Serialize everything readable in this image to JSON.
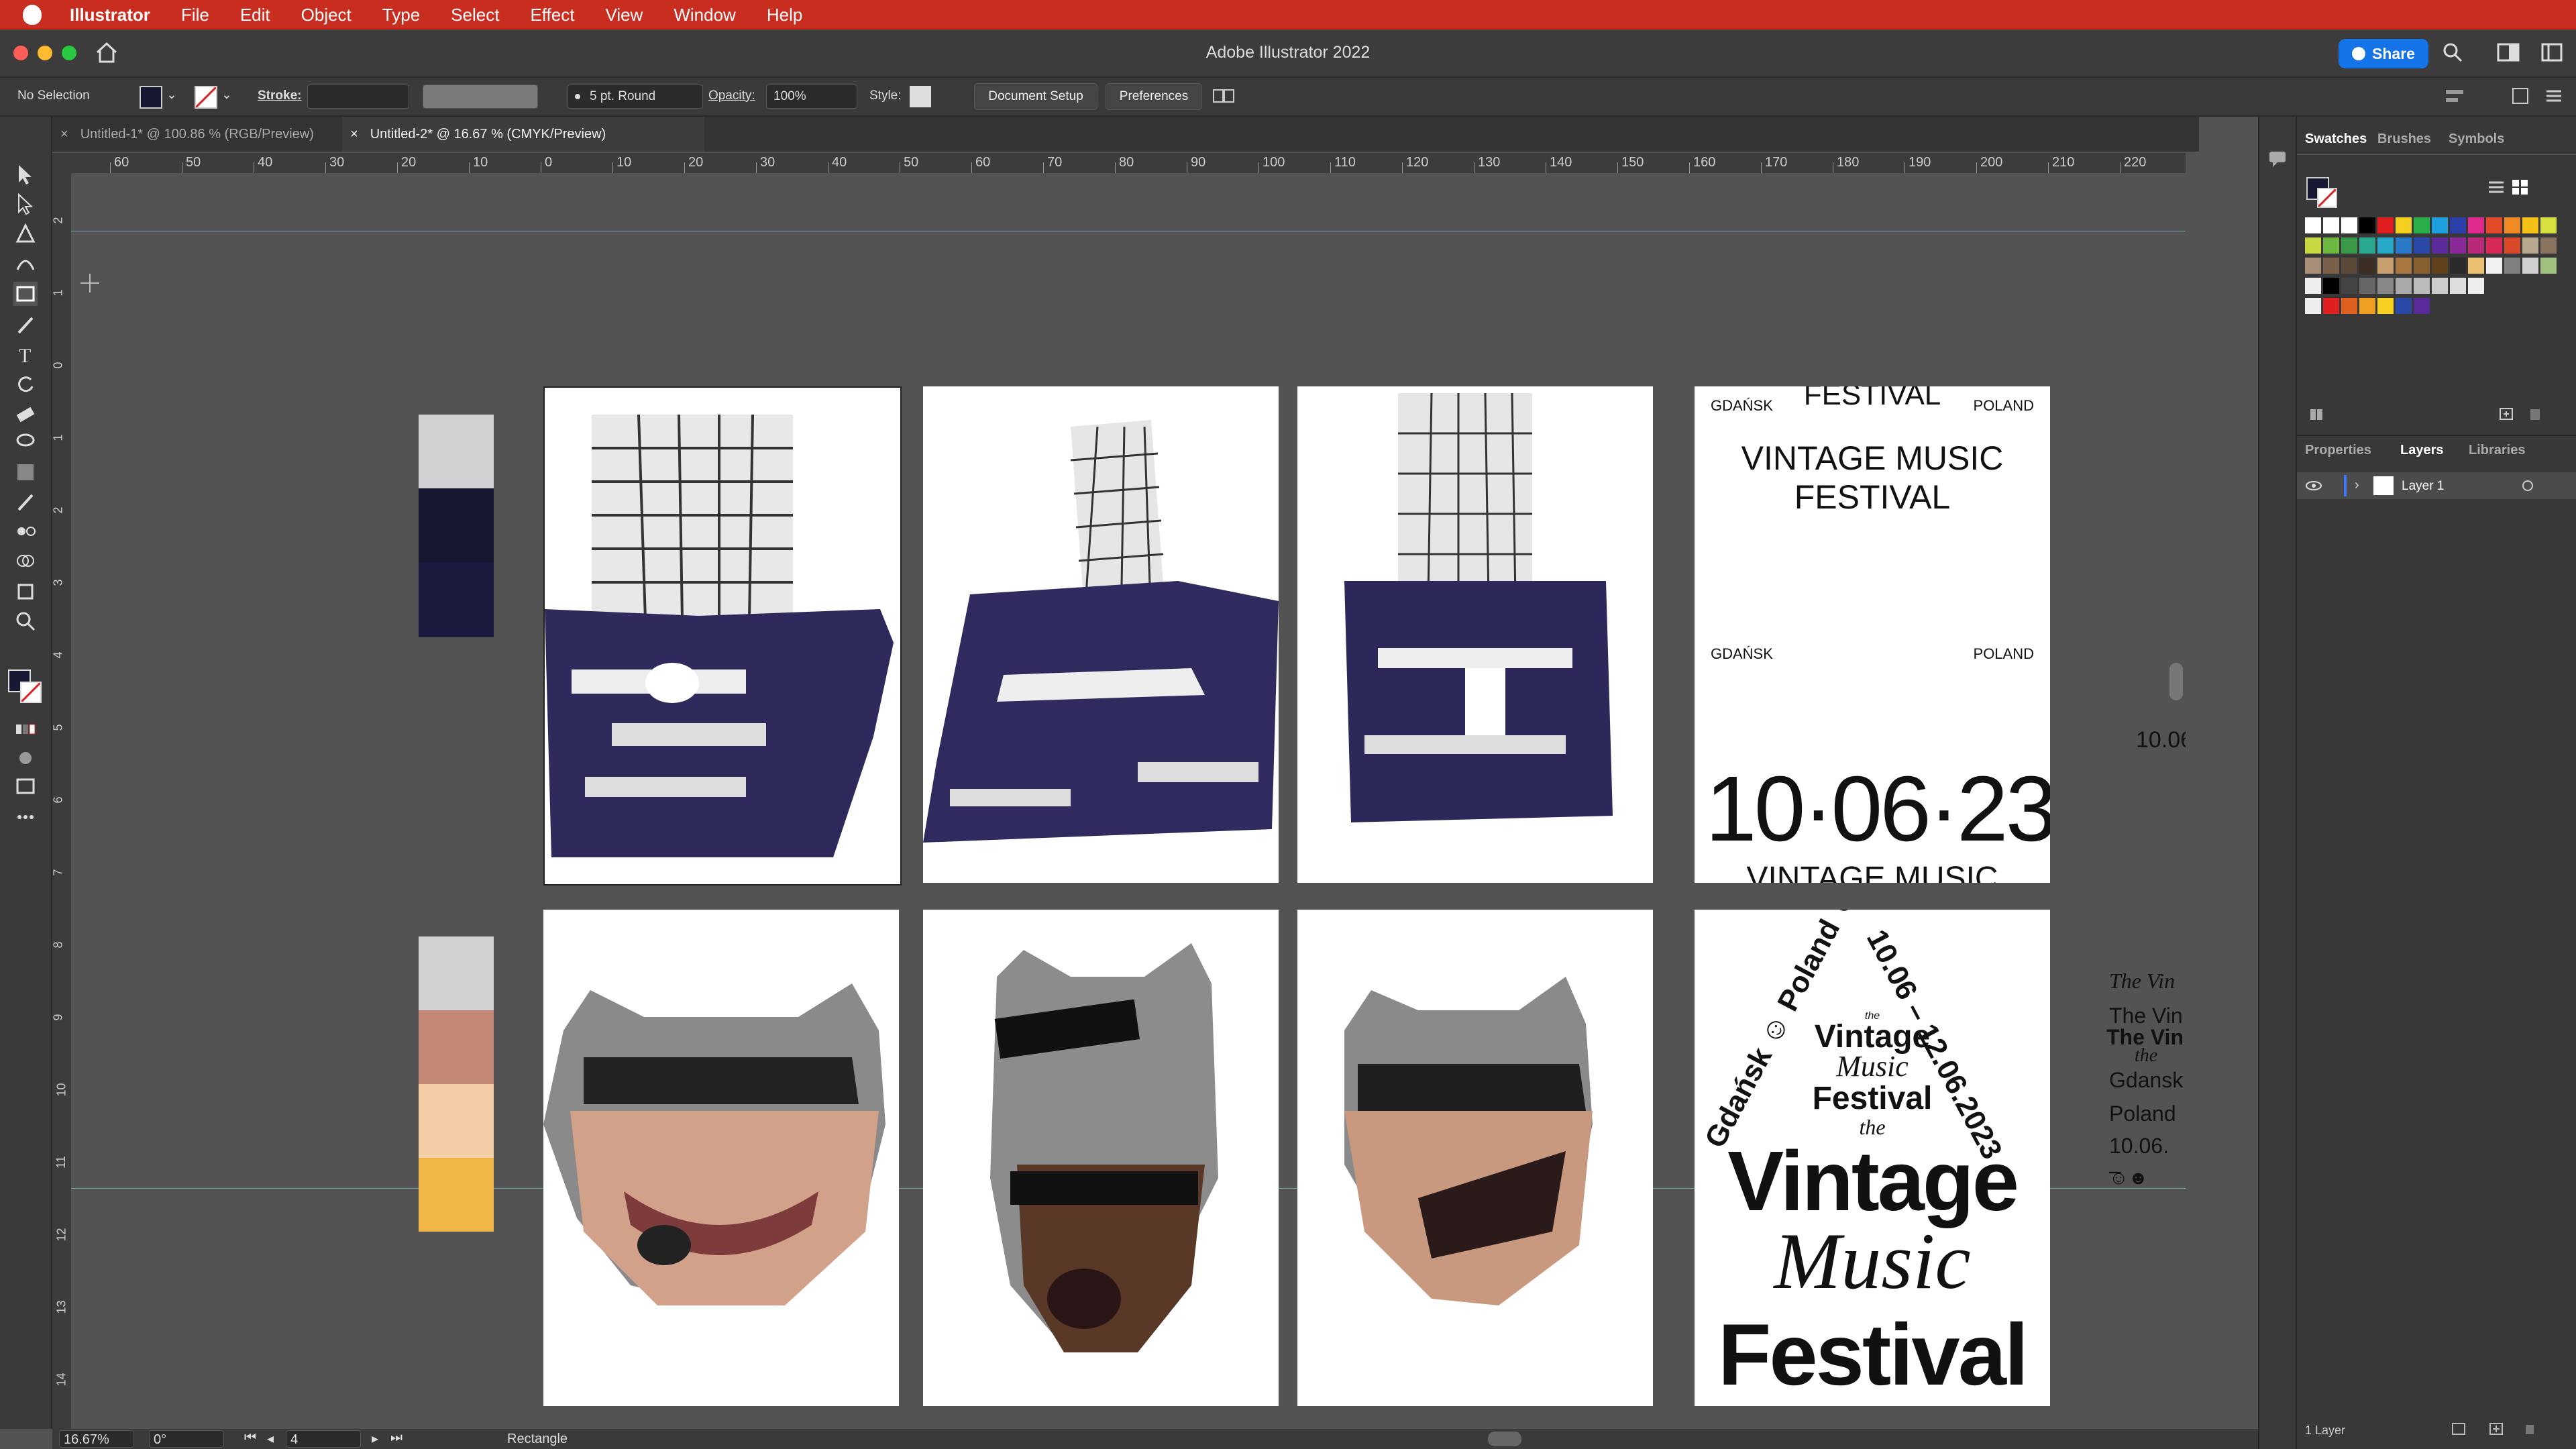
{
  "menubar": {
    "app": "Illustrator",
    "items": [
      "File",
      "Edit",
      "Object",
      "Type",
      "Select",
      "Effect",
      "View",
      "Window",
      "Help"
    ]
  },
  "window": {
    "title": "Adobe Illustrator 2022",
    "share_label": "Share"
  },
  "controlbar": {
    "selection": "No Selection",
    "stroke_label": "Stroke:",
    "brush": "5 pt. Round",
    "opacity_label": "Opacity:",
    "opacity_value": "100%",
    "style_label": "Style:",
    "document_setup": "Document Setup",
    "preferences": "Preferences"
  },
  "tabs": [
    {
      "label": "Untitled-1* @ 100.86 % (RGB/Preview)",
      "active": false
    },
    {
      "label": "Untitled-2* @ 16.67 % (CMYK/Preview)",
      "active": true
    }
  ],
  "ruler": {
    "h_ticks": [
      "60",
      "50",
      "40",
      "30",
      "20",
      "10",
      "0",
      "10",
      "20",
      "30",
      "40",
      "50",
      "60",
      "70",
      "80",
      "90",
      "100",
      "110",
      "120",
      "130",
      "140",
      "150",
      "160",
      "170",
      "180",
      "190",
      "200",
      "210",
      "220"
    ],
    "v_ticks": [
      "2",
      "1",
      "0",
      "1",
      "2",
      "3",
      "4",
      "5",
      "6",
      "7",
      "8",
      "9",
      "10",
      "11",
      "12",
      "13",
      "14"
    ]
  },
  "colors": {
    "menubar": "#c92d20",
    "accent": "#1473e6",
    "navy": "#151830",
    "navy_dark": "#1c1a3e",
    "light_gray": "#d2d2d4",
    "terracotta": "#c38776",
    "peach": "#f2cda5",
    "mustard": "#efb547"
  },
  "posters": {
    "top": {
      "city": "GDAŃSK",
      "country": "POLAND",
      "cropped_top": "FESTIVAL",
      "title_line1": "VINTAGE MUSIC",
      "title_line2": "FESTIVAL",
      "city2": "GDAŃSK",
      "country2": "POLAND",
      "date": "10·06·23",
      "cropped_bottom": "VINTAGE MUSIC"
    },
    "bottom": {
      "arc_left": "Gdańsk ☺ Poland ☺",
      "arc_right": "10.06 – 12.06.2023",
      "the1": "the",
      "vintage_small": "Vintage",
      "music_small": "Music",
      "festival_small": "Festival",
      "the2": "the",
      "vintage_big": "Vintage",
      "music_big": "Music",
      "festival_big": "Festival"
    },
    "offboard_top": "10.06",
    "offboard_bottom": [
      "The Vin",
      "The Vin",
      "The Vin",
      "the",
      "Gdansk",
      "Poland",
      "10.06. –",
      "☺☻"
    ]
  },
  "panels": {
    "tabs_top": [
      "Swatches",
      "Brushes",
      "Symbols"
    ],
    "tabs_bottom": [
      "Properties",
      "Layers",
      "Libraries"
    ],
    "layer_name": "Layer 1",
    "layers_count": "1 Layer"
  },
  "statusbar": {
    "zoom": "16.67%",
    "rotation": "0°",
    "artboard": "4",
    "tool": "Rectangle"
  }
}
